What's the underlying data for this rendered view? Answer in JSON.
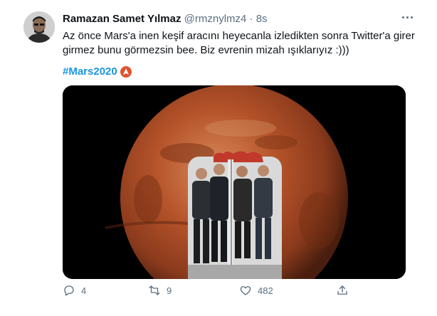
{
  "author": {
    "display_name": "Ramazan Samet Yılmaz",
    "handle": "@rmznylmz4",
    "separator": "·",
    "time": "8s"
  },
  "tweet": {
    "text": "Az önce Mars'a inen keşif aracını heyecanla izledikten sonra Twitter'a girer girmez bunu görmezsin bee. Biz evrenin mizah ışıklarıyız :)))",
    "hashtag": "#Mars2020"
  },
  "actions": {
    "reply_count": "4",
    "retweet_count": "9",
    "like_count": "482"
  },
  "icons": {
    "more": "more-dots-icon",
    "reply": "reply-icon",
    "retweet": "retweet-icon",
    "like": "heart-icon",
    "share": "share-icon",
    "hashflag": "mars-perseverance-hashflag"
  },
  "colors": {
    "hashtag": "#1b95e0",
    "muted": "#5b7083",
    "text": "#0f1419",
    "mars": "#b5532a"
  }
}
